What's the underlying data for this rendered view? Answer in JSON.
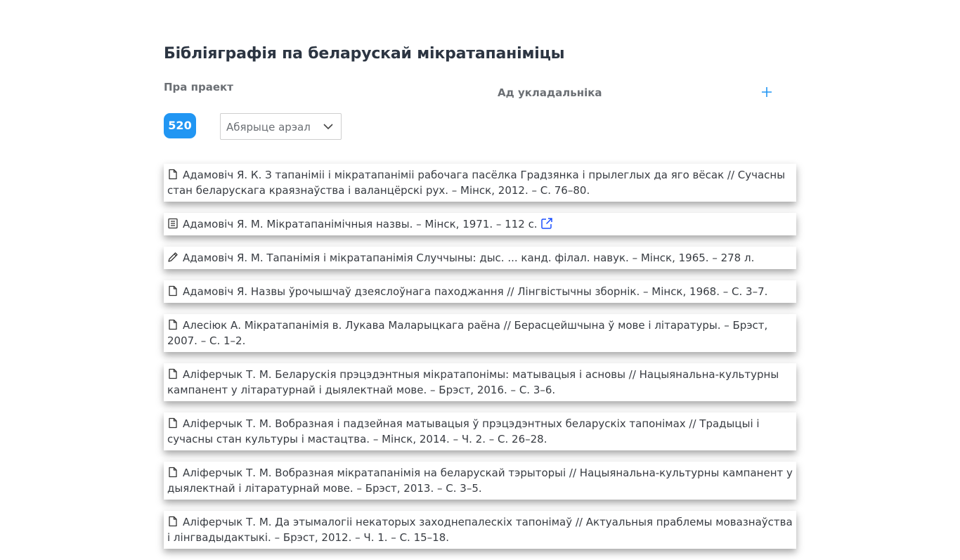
{
  "header": {
    "title": "Бібліяграфія па беларускай мікратапаніміцы",
    "about_label": "Пра праект",
    "compiler_label": "Ад укладальніка"
  },
  "filters": {
    "count": "520",
    "area_placeholder": "Абярыце арэал"
  },
  "colors": {
    "accent": "#2196f3"
  },
  "entries": [
    {
      "icon": "document-icon",
      "text": "Адамовіч Я. К. З тапаніміі і мікратапаніміі рабочага пасёлка Градзянка і прылеглых да яго вёсак // Сучасны стан беларускага краязнаўства і валанцёрскі рух. – Мінск, 2012. – С. 76–80."
    },
    {
      "icon": "book-icon",
      "text": "Адамовіч Я. М. Мікратапанімічныя назвы. – Мінск, 1971. – 112 с.",
      "external_link_icon": "external-link-icon"
    },
    {
      "icon": "pencil-icon",
      "text": "Адамовіч Я. М. Тапанімія і мікратапанімія Случчыны: дыс. ... канд. філал. навук. – Мінск, 1965. – 278 л."
    },
    {
      "icon": "document-icon",
      "text": "Адамовіч Я. Назвы ўрочышчаў дзеяслоўнага паходжання // Лінгвістычны зборнік. – Мінск, 1968. – С. 3–7."
    },
    {
      "icon": "document-icon",
      "text": "Алесіюк А. Мікратапанімія в. Лукава Маларыцкага раёна // Берасцейшчына ў мове і літаратуры. – Брэст, 2007. – С. 1–2."
    },
    {
      "icon": "document-icon",
      "text": "Аліферчык Т. М. Беларускія прэцэдэнтныя мікратапонімы: матывацыя і асновы // Нацыянальна-культурны кампанент у літаратурнай і дыялектнай мове. – Брэст, 2016. – С. 3–6."
    },
    {
      "icon": "document-icon",
      "text": "Аліферчык Т. М. Вобразная і падзейная матывацыя ў прэцэдэнтных беларускіх тапонімах // Традыцыі і сучасны стан культуры і мастацтва. – Мінск, 2014. – Ч. 2. – С. 26–28."
    },
    {
      "icon": "document-icon",
      "text": "Аліферчык Т. М. Вобразная мікратапанімія на беларускай тэрыторыі // Нацыянальна-культурны кампанент у дыялектнай і літаратурнай мове. – Брэст, 2013. – С. 3–5."
    },
    {
      "icon": "document-icon",
      "text": "Аліферчык Т. М. Да этымалогіі некаторых заходнепалескіх тапонімаў // Актуальныя праблемы мовазнаўства і лінгвадыдактыкі. – Брэст, 2012. – Ч. 1. – С. 15–18."
    }
  ]
}
